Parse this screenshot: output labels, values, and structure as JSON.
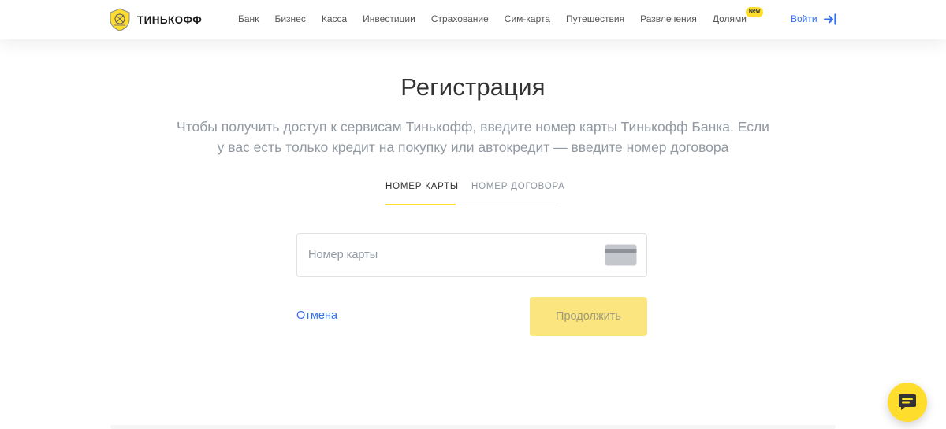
{
  "header": {
    "logo_text": "ТИНЬКОФФ",
    "nav": [
      {
        "label": "Банк"
      },
      {
        "label": "Бизнес"
      },
      {
        "label": "Касса"
      },
      {
        "label": "Инвестиции"
      },
      {
        "label": "Страхование"
      },
      {
        "label": "Сим-карта"
      },
      {
        "label": "Путешествия"
      },
      {
        "label": "Развлечения"
      },
      {
        "label": "Долями",
        "badge": "New"
      }
    ],
    "login_label": "Войти",
    "login_icon": "login-arrow-icon"
  },
  "main": {
    "title": "Регистрация",
    "subtitle_line1": "Чтобы получить доступ к сервисам Тинькофф, введите номер карты Тинькофф Банка. Если",
    "subtitle_line2": "у вас есть только кредит на покупку или автокредит — введите номер договора",
    "tabs": [
      {
        "label": "Номер карты",
        "active": true
      },
      {
        "label": "Номер договора",
        "active": false
      }
    ],
    "card_field": {
      "placeholder": "Номер карты",
      "value": "",
      "icon": "credit-card-icon"
    },
    "cancel_label": "Отмена",
    "continue_label": "Продолжить"
  },
  "chat": {
    "icon": "chat-icon"
  },
  "colors": {
    "accent_yellow": "#ffdd2d",
    "button_disabled": "#fbe57f",
    "link_blue": "#336fee",
    "muted_text": "#9299a2"
  }
}
